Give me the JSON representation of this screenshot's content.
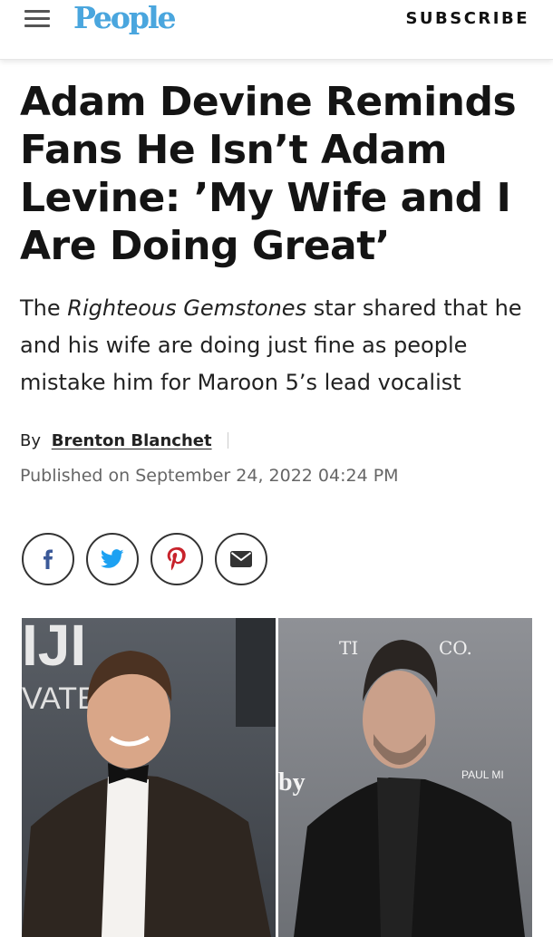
{
  "header": {
    "logo": "People",
    "subscribe_label": "SUBSCRIBE"
  },
  "article": {
    "headline": "Adam Devine Reminds Fans He Isn’t Adam Levine: ’My Wife and I Are Doing Great’",
    "dek_prefix": "The ",
    "dek_italic": "Righteous Gemstones",
    "dek_suffix": " star shared that he and his wife are doing just fine as people mistake him for Maroon 5’s lead vocalist",
    "byline_prefix": "By",
    "author": "Brenton Blanchet",
    "published": "Published on September 24, 2022 04:24 PM"
  },
  "share": [
    {
      "network": "facebook",
      "icon": "facebook-icon"
    },
    {
      "network": "twitter",
      "icon": "twitter-icon"
    },
    {
      "network": "pinterest",
      "icon": "pinterest-icon"
    },
    {
      "network": "email",
      "icon": "email-icon"
    }
  ],
  "photo": {
    "left_backdrop_text": [
      "IJI",
      "VATER"
    ],
    "right_backdrop_text": [
      "TI",
      "CO.",
      "by",
      "PAUL MI"
    ]
  },
  "colors": {
    "logo": "#4aa6de",
    "text": "#141414",
    "muted": "#666666"
  }
}
